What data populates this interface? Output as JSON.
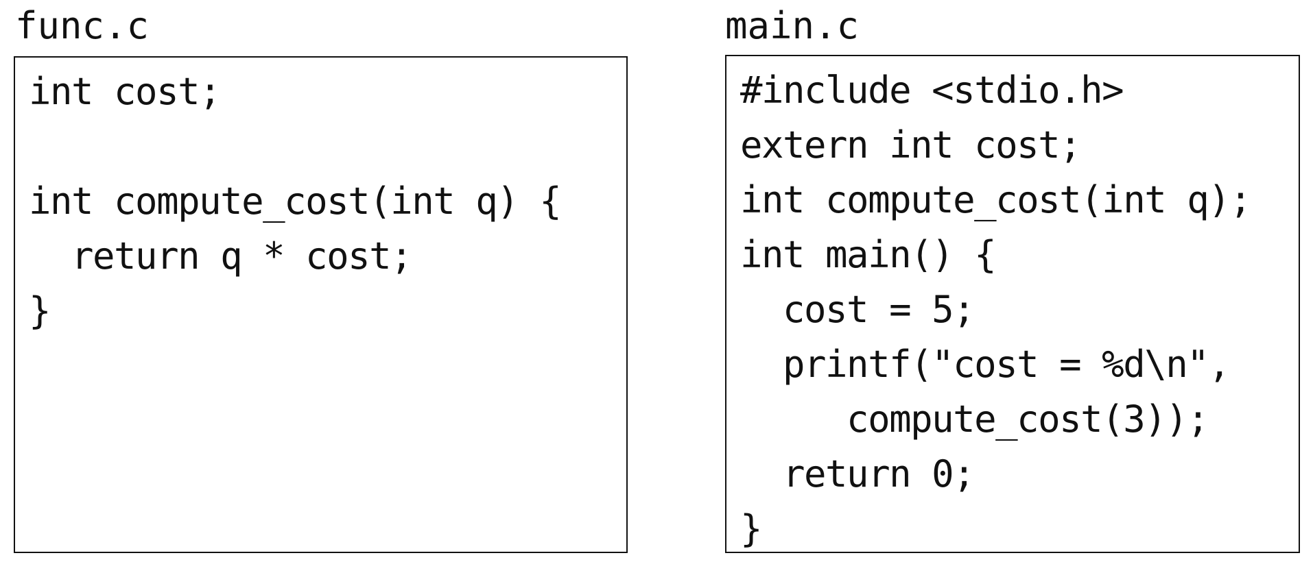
{
  "func_file": {
    "name": "func.c",
    "lines": [
      "int cost;",
      "",
      "int compute_cost(int q) {",
      "  return q * cost;",
      "}"
    ]
  },
  "main_file": {
    "name": "main.c",
    "lines": [
      "#include <stdio.h>",
      "extern int cost;",
      "int compute_cost(int q);",
      "int main() {",
      "  cost = 5;",
      "  printf(\"cost = %d\\n\",",
      "     compute_cost(3));",
      "  return 0;",
      "}"
    ]
  }
}
